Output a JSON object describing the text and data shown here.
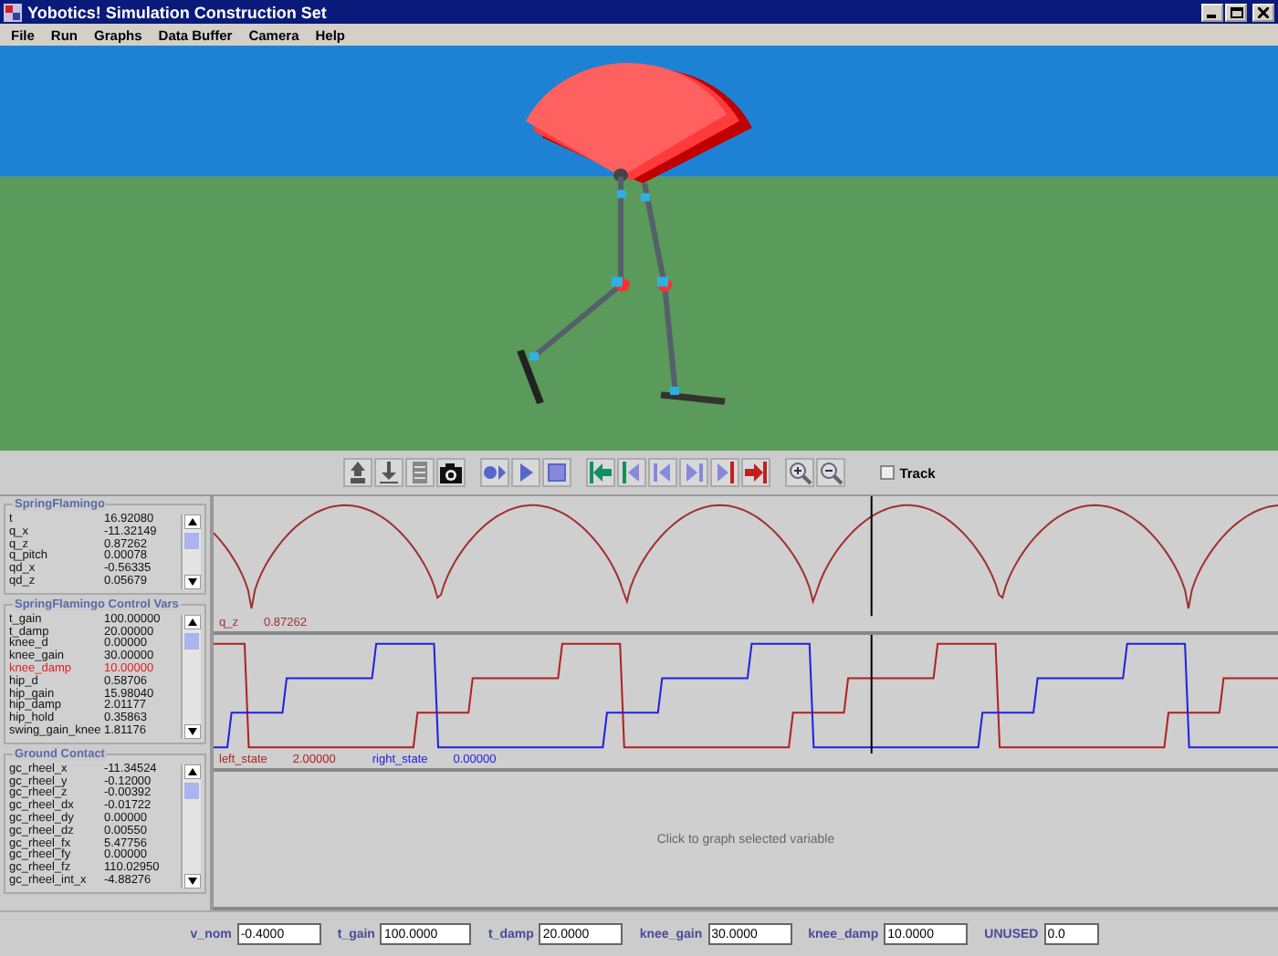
{
  "window": {
    "title": "Yobotics!  Simulation Construction Set"
  },
  "menu": [
    "File",
    "Run",
    "Graphs",
    "Data Buffer",
    "Camera",
    "Help"
  ],
  "toolbar": {
    "track": {
      "label": "Track",
      "checked": false
    }
  },
  "variable_panels": [
    {
      "title": "SpringFlamingo",
      "variables": [
        {
          "name": "t",
          "value": "16.92080",
          "selected": false
        },
        {
          "name": "q_x",
          "value": "-11.32149",
          "selected": false
        },
        {
          "name": "q_z",
          "value": "0.87262",
          "selected": false
        },
        {
          "name": "q_pitch",
          "value": "0.00078",
          "selected": false
        },
        {
          "name": "qd_x",
          "value": "-0.56335",
          "selected": false
        },
        {
          "name": "qd_z",
          "value": "0.05679",
          "selected": false
        }
      ]
    },
    {
      "title": "SpringFlamingo Control Vars",
      "variables": [
        {
          "name": "t_gain",
          "value": "100.00000",
          "selected": false
        },
        {
          "name": "t_damp",
          "value": "20.00000",
          "selected": false
        },
        {
          "name": "knee_d",
          "value": "0.00000",
          "selected": false
        },
        {
          "name": "knee_gain",
          "value": "30.00000",
          "selected": false
        },
        {
          "name": "knee_damp",
          "value": "10.00000",
          "selected": true
        },
        {
          "name": "hip_d",
          "value": "0.58706",
          "selected": false
        },
        {
          "name": "hip_gain",
          "value": "15.98040",
          "selected": false
        },
        {
          "name": "hip_damp",
          "value": "2.01177",
          "selected": false
        },
        {
          "name": "hip_hold",
          "value": "0.35863",
          "selected": false
        },
        {
          "name": "swing_gain_knee",
          "value": "1.81176",
          "selected": false
        }
      ]
    },
    {
      "title": "Ground Contact",
      "variables": [
        {
          "name": "gc_rheel_x",
          "value": "-11.34524",
          "selected": false
        },
        {
          "name": "gc_rheel_y",
          "value": "-0.12000",
          "selected": false
        },
        {
          "name": "gc_rheel_z",
          "value": "-0.00392",
          "selected": false
        },
        {
          "name": "gc_rheel_dx",
          "value": "-0.01722",
          "selected": false
        },
        {
          "name": "gc_rheel_dy",
          "value": "0.00000",
          "selected": false
        },
        {
          "name": "gc_rheel_dz",
          "value": "0.00550",
          "selected": false
        },
        {
          "name": "gc_rheel_fx",
          "value": "5.47756",
          "selected": false
        },
        {
          "name": "gc_rheel_fy",
          "value": "0.00000",
          "selected": false
        },
        {
          "name": "gc_rheel_fz",
          "value": "110.02950",
          "selected": false
        },
        {
          "name": "gc_rheel_int_x",
          "value": "-4.88276",
          "selected": false
        }
      ]
    }
  ],
  "graphs": [
    {
      "kind": "trace",
      "traces": [
        {
          "kind": "arch",
          "name": "q_z",
          "value": "0.87262",
          "color": "#a03030"
        }
      ]
    },
    {
      "kind": "trace",
      "traces": [
        {
          "kind": "step",
          "name": "left_state",
          "value": "2.00000",
          "color": "#b02020"
        },
        {
          "kind": "step",
          "name": "right_state",
          "value": "0.00000",
          "color": "#2020e0"
        }
      ]
    },
    {
      "kind": "empty",
      "hint": "Click to graph selected variable"
    }
  ],
  "entries": [
    {
      "label": "v_nom",
      "value": "-0.4000"
    },
    {
      "label": "t_gain",
      "value": "100.0000"
    },
    {
      "label": "t_damp",
      "value": "20.0000"
    },
    {
      "label": "knee_gain",
      "value": "30.0000"
    },
    {
      "label": "knee_damp",
      "value": "10.0000"
    },
    {
      "label": "UNUSED",
      "value": "0.0"
    }
  ]
}
